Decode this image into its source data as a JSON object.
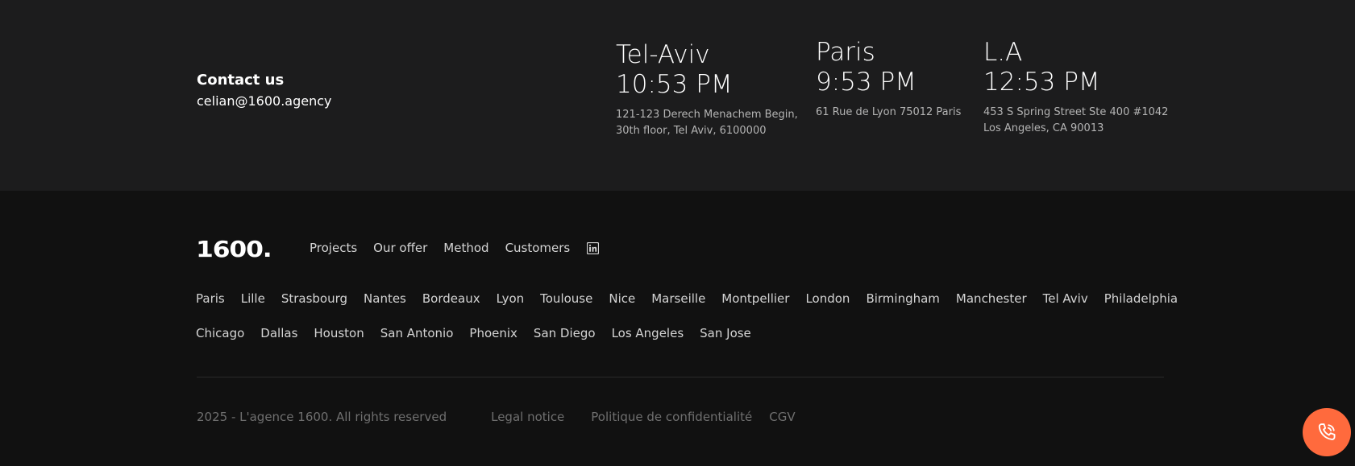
{
  "contact": {
    "heading": "Contact us",
    "email": "celian@1600.agency"
  },
  "offices": [
    {
      "city": "Tel-Aviv",
      "time": "10:53 PM",
      "address_line1": "121-123 Derech Menachem Begin,",
      "address_line2": "30th floor, Tel Aviv, 6100000"
    },
    {
      "city": "Paris",
      "time": "9:53 PM",
      "address_line1": "61 Rue de Lyon 75012 Paris",
      "address_line2": ""
    },
    {
      "city": "L.A",
      "time": "12:53 PM",
      "address_line1": "453 S Spring Street Ste 400 #1042",
      "address_line2": "Los Angeles, CA 90013"
    }
  ],
  "footer": {
    "logo": "1600.",
    "nav": [
      "Projects",
      "Our offer",
      "Method",
      "Customers"
    ],
    "social_icon": "linkedin-icon",
    "cities_row1": [
      "Paris",
      "Lille",
      "Strasbourg",
      "Nantes",
      "Bordeaux",
      "Lyon",
      "Toulouse",
      "Nice",
      "Marseille",
      "Montpellier",
      "London",
      "Birmingham",
      "Manchester",
      "Tel Aviv",
      "Philadelphia"
    ],
    "cities_row2": [
      "Chicago",
      "Dallas",
      "Houston",
      "San Antonio",
      "Phoenix",
      "San Diego",
      "Los Angeles",
      "San Jose"
    ],
    "copyright": "2025 - L'agence 1600. All rights reserved",
    "legal_links": [
      "Legal notice",
      "Politique de confidentialité",
      "CGV"
    ]
  },
  "call_button": {
    "icon": "phone-icon",
    "color": "#ff6a3d"
  },
  "colors": {
    "contact_band_bg": "#1c1c1d",
    "footer_bg": "#111111",
    "accent": "#ff6a3d"
  }
}
